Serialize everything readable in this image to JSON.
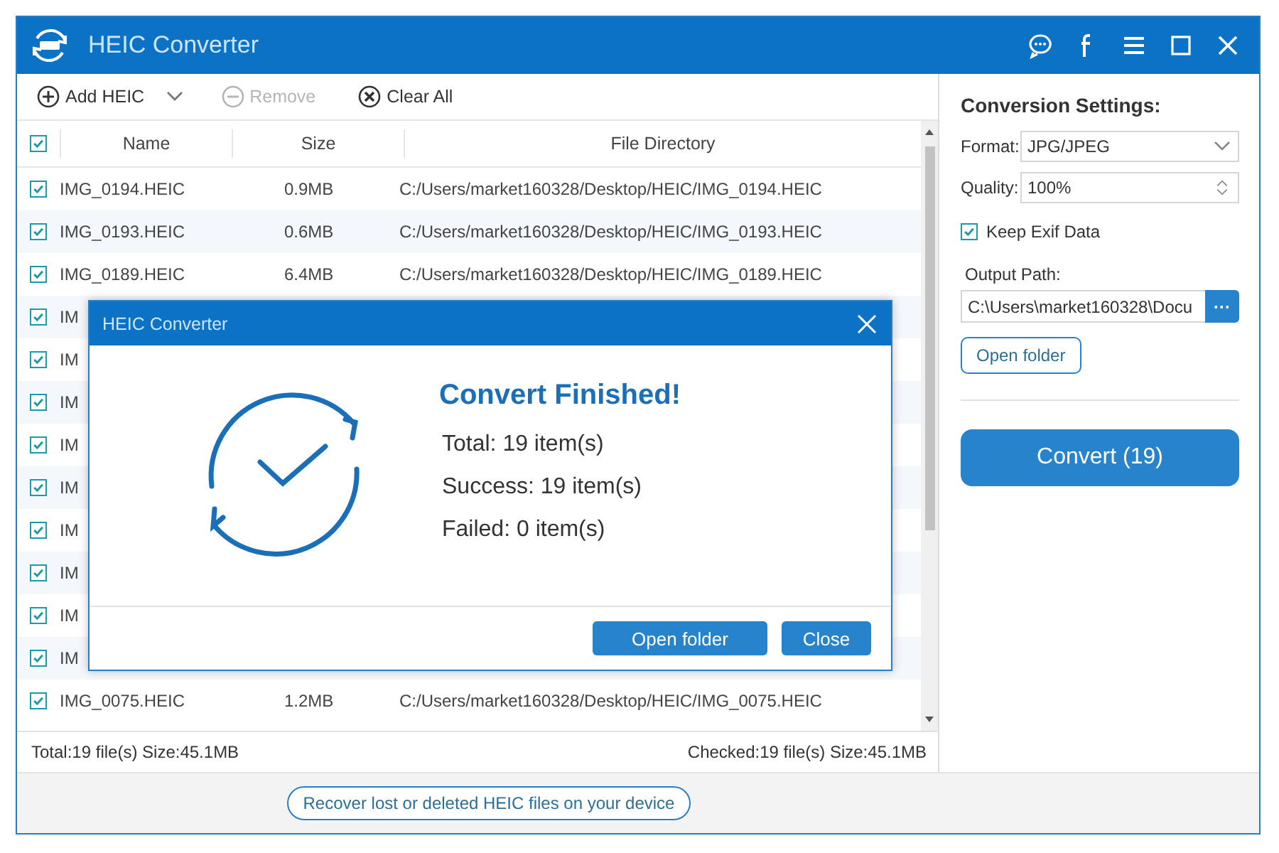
{
  "window": {
    "title": "HEIC Converter"
  },
  "toolbar": [
    {
      "kind": "add",
      "label": "Add HEIC",
      "disabled": false
    },
    {
      "kind": "remove",
      "label": "Remove",
      "disabled": true
    },
    {
      "kind": "clear",
      "label": "Clear All",
      "disabled": false
    }
  ],
  "table": {
    "all_checked": true,
    "columns": [
      "Name",
      "Size",
      "File Directory"
    ],
    "rows": [
      {
        "checked": true,
        "name": "IMG_0194.HEIC",
        "size": "0.9MB",
        "path": "C:/Users/market160328/Desktop/HEIC/IMG_0194.HEIC"
      },
      {
        "checked": true,
        "name": "IMG_0193.HEIC",
        "size": "0.6MB",
        "path": "C:/Users/market160328/Desktop/HEIC/IMG_0193.HEIC"
      },
      {
        "checked": true,
        "name": "IMG_0189.HEIC",
        "size": "6.4MB",
        "path": "C:/Users/market160328/Desktop/HEIC/IMG_0189.HEIC"
      },
      {
        "checked": true,
        "name": "IM"
      },
      {
        "checked": true,
        "name": "IM"
      },
      {
        "checked": true,
        "name": "IM"
      },
      {
        "checked": true,
        "name": "IM"
      },
      {
        "checked": true,
        "name": "IM"
      },
      {
        "checked": true,
        "name": "IM"
      },
      {
        "checked": true,
        "name": "IM"
      },
      {
        "checked": true,
        "name": "IM"
      },
      {
        "checked": true,
        "name": "IM"
      },
      {
        "checked": true,
        "name": "IMG_0075.HEIC",
        "size": "1.2MB",
        "path": "C:/Users/market160328/Desktop/HEIC/IMG_0075.HEIC"
      }
    ]
  },
  "status_bar": {
    "left": "Total:19 file(s) Size:45.1MB",
    "right": "Checked:19 file(s) Size:45.1MB"
  },
  "recover_link": "Recover lost or deleted HEIC files on your device",
  "settings": {
    "title": "Conversion Settings:",
    "format_label": "Format:",
    "format": "JPG/JPEG",
    "quality_label": "Quality:",
    "quality": "100%",
    "keep_exif": {
      "label": "Keep Exif Data",
      "checked": true
    },
    "output_label": "Output Path:",
    "output_path": "C:\\Users\\market160328\\Docu",
    "browse": "···",
    "open_folder": "Open folder",
    "convert": "Convert (19)"
  },
  "dialog": {
    "title": "HEIC Converter",
    "heading": "Convert Finished!",
    "lines": [
      "Total: 19 item(s)",
      "Success: 19 item(s)",
      "Failed: 0 item(s)"
    ],
    "buttons": [
      "Open folder",
      "Close"
    ]
  }
}
